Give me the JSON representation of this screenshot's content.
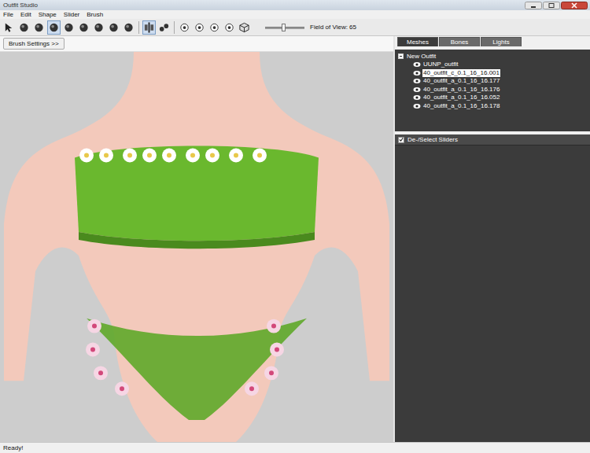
{
  "window": {
    "title": "Outfit Studio"
  },
  "menu": [
    "File",
    "Edit",
    "Shape",
    "Slider",
    "Brush"
  ],
  "toolbar": {
    "tools": [
      {
        "kind": "cursor",
        "selected": false
      },
      {
        "kind": "brush",
        "selected": false
      },
      {
        "kind": "brush",
        "selected": false
      },
      {
        "kind": "brush",
        "selected": true
      },
      {
        "kind": "brush",
        "selected": false
      },
      {
        "kind": "brush",
        "selected": false
      },
      {
        "kind": "brush",
        "selected": false
      },
      {
        "kind": "brush",
        "selected": false
      },
      {
        "kind": "brush",
        "selected": false
      },
      {
        "kind": "mirror",
        "selected": true
      },
      {
        "kind": "link",
        "selected": false
      },
      {
        "kind": "dot",
        "selected": false
      },
      {
        "kind": "dot",
        "selected": false
      },
      {
        "kind": "dot",
        "selected": false
      },
      {
        "kind": "dot",
        "selected": false
      },
      {
        "kind": "cube",
        "selected": false
      }
    ],
    "fov": {
      "label": "Field of View: 65",
      "level": 0.46
    }
  },
  "brush_settings": "Brush Settings >>",
  "tabs": [
    {
      "label": "Meshes",
      "selected": true
    },
    {
      "label": "Bones",
      "selected": false
    },
    {
      "label": "Lights",
      "selected": false
    }
  ],
  "tree": {
    "root": "New Outfit",
    "expanded": true,
    "items": [
      {
        "label": "UUNP_outfit",
        "visible": true,
        "selected": false
      },
      {
        "label": "40_outfit_c_0.1_16_16.001",
        "visible": true,
        "selected": true
      },
      {
        "label": "40_outfit_a_0.1_16_16.177",
        "visible": true,
        "selected": false
      },
      {
        "label": "40_outfit_a_0.1_16_16.176",
        "visible": true,
        "selected": false
      },
      {
        "label": "40_outfit_a_0.1_16_16.052",
        "visible": true,
        "selected": false
      },
      {
        "label": "40_outfit_a_0.1_16_16.178",
        "visible": true,
        "selected": false
      }
    ]
  },
  "sliders_header": {
    "label": "De-/Select Sliders",
    "checked": true
  },
  "status_bar": "Ready!"
}
